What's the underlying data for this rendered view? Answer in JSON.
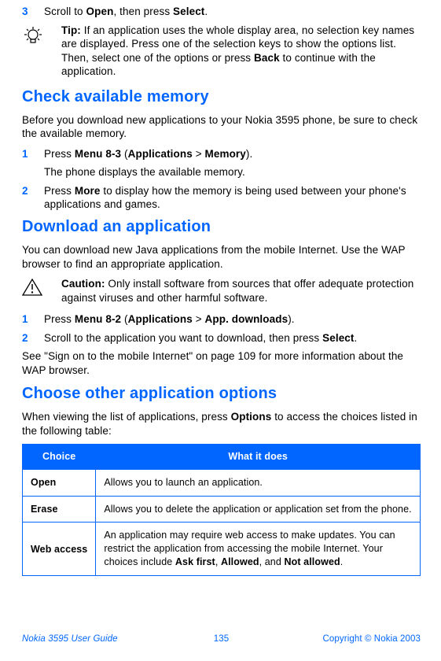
{
  "step3": {
    "num": "3",
    "text_pre": "Scroll to ",
    "bold1": "Open",
    "text_mid": ", then press ",
    "bold2": "Select",
    "text_post": "."
  },
  "tip": {
    "label": "Tip:",
    "text": " If an application uses the whole display area, no selection key names are displayed. Press one of the selection keys to show the options list. Then, select one of the options or press ",
    "bold": "Back",
    "text2": " to continue with the application."
  },
  "h_memory": "Check available memory",
  "memory_intro": "Before you download new applications to your Nokia 3595 phone, be sure to check the available memory.",
  "mem_s1": {
    "num": "1",
    "pre": "Press ",
    "b1": "Menu 8-3",
    "mid": " (",
    "b2": "Applications",
    "sep": " > ",
    "b3": "Memory",
    "post": ").",
    "sub": "The phone displays the available memory."
  },
  "mem_s2": {
    "num": "2",
    "pre": "Press ",
    "b1": "More",
    "post": " to display how the memory is being used between your phone's applications and games."
  },
  "h_download": "Download an application",
  "download_intro": "You can download new Java applications from the mobile Internet. Use the WAP browser to find an appropriate application.",
  "caution": {
    "label": "Caution:",
    "text": " Only install software from sources that offer adequate protection against viruses and other harmful software."
  },
  "dl_s1": {
    "num": "1",
    "pre": "Press ",
    "b1": "Menu 8-2",
    "mid": " (",
    "b2": "Applications",
    "sep": " > ",
    "b3": "App. downloads",
    "post": ")."
  },
  "dl_s2": {
    "num": "2",
    "pre": "Scroll to the application you want to download, then press ",
    "b1": "Select",
    "post": "."
  },
  "download_outro": "See \"Sign on to the mobile Internet\" on page 109 for more information about the WAP browser.",
  "h_options": "Choose other application options",
  "options_intro_pre": "When viewing the list of applications, press ",
  "options_intro_b": "Options",
  "options_intro_post": " to access the choices listed in the following table:",
  "table": {
    "h1": "Choice",
    "h2": "What it does",
    "rows": [
      {
        "choice": "Open",
        "desc": "Allows you to launch an application."
      },
      {
        "choice": "Erase",
        "desc": "Allows you to delete the application or application set from the phone."
      },
      {
        "choice": "Web access",
        "desc_pre": "An application may require web access to make updates. You can restrict the application from accessing the mobile Internet. Your choices include ",
        "b1": "Ask first",
        "sep1": ", ",
        "b2": "Allowed",
        "sep2": ", and ",
        "b3": "Not allowed",
        "post": "."
      }
    ]
  },
  "footer": {
    "left": "Nokia 3595 User Guide",
    "center": "135",
    "right": "Copyright © Nokia 2003"
  }
}
